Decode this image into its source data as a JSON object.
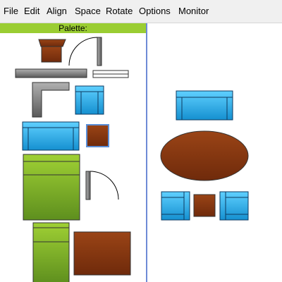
{
  "menu": {
    "items": [
      "File",
      "Edit",
      "Align",
      "Space",
      "Rotate",
      "Options",
      "Monitor"
    ]
  },
  "palette": {
    "title": "Palette:",
    "items": [
      "table-icon",
      "door-icon",
      "wall-icon",
      "window-icon",
      "corner-wall-icon",
      "armchair-icon",
      "sofa-icon",
      "end-table-icon",
      "double-bed-icon",
      "door-icon",
      "single-bed-icon",
      "rectangular-table-icon"
    ]
  },
  "canvas": {
    "items": [
      "sofa-icon",
      "oval-table-icon",
      "armchair-icon",
      "end-table-icon",
      "armchair-icon"
    ]
  },
  "colors": {
    "menu_bg": "#f0f0f0",
    "palette_header": "#9acd32",
    "divider": "#6e8bd6",
    "wood": "#8b3a12",
    "fabric_blue": "#29a8e0",
    "bed_green": "#7cb32a",
    "wall_gray": "#8a8a8a"
  }
}
